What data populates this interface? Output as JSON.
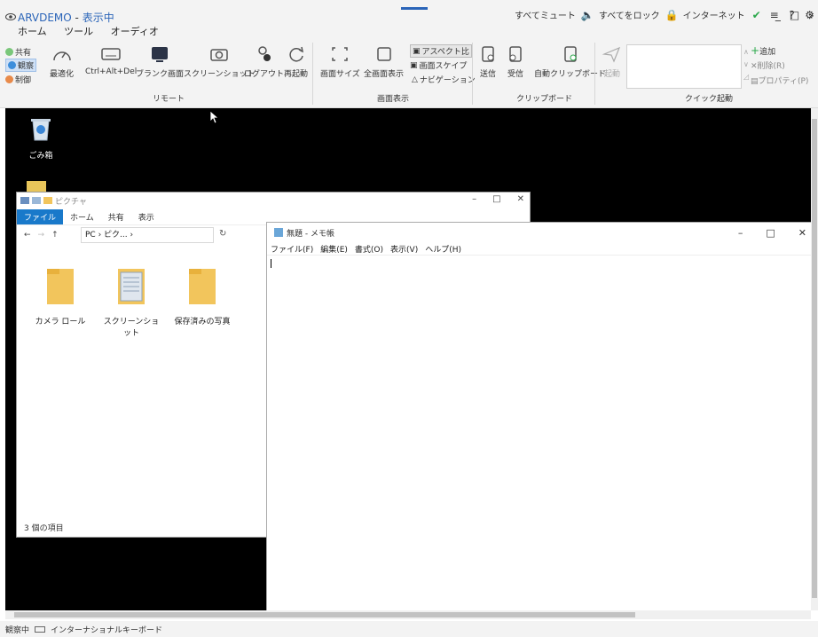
{
  "app": {
    "name": "ARVDEMO",
    "dash": " - ",
    "state": "表示中",
    "tabs": [
      "ホーム",
      "ツール",
      "オーディオ"
    ]
  },
  "top_right": {
    "mute_all": "すべてミュート",
    "lock_all": "すべてをロック",
    "internet": "インターネット",
    "icons": [
      "speaker-icon",
      "lock-icon",
      "check-circle-icon",
      "menu-icon",
      "help-icon",
      "gear-icon"
    ]
  },
  "ribbon": {
    "mode": {
      "share": "共有",
      "view": "観察",
      "control": "制御"
    },
    "remote": {
      "optimize": "最適化",
      "ctrl_alt_del": "Ctrl+Alt+Del",
      "blank_screen": "ブランク画面",
      "screenshot": "スクリーンショット",
      "logout": "ログアウト",
      "restart": "再起動",
      "group_label": "リモート"
    },
    "display": {
      "screen_size": "画面サイズ",
      "fullscreen": "全画面表示",
      "aspect": "アスペクト比",
      "screen_scale": "画面スケイプ",
      "navigation": "ナビゲーション",
      "group_label": "画面表示"
    },
    "clipboard": {
      "send": "送信",
      "receive": "受信",
      "auto_clipboard": "自動クリップボード",
      "group_label": "クリップボード"
    },
    "quick": {
      "launch": "起動",
      "add": "追加",
      "delete": "削除(R)",
      "properties": "プロパティ(P)",
      "group_label": "クイック起動"
    }
  },
  "desktop": {
    "recycle_bin": "ごみ箱",
    "explorer": {
      "title": "ピクチャ",
      "tabs": [
        "ファイル",
        "ホーム",
        "共有",
        "表示"
      ],
      "address": "PC › ピク... ›",
      "folders": [
        "カメラ ロール",
        "スクリーンショット",
        "保存済みの写真"
      ],
      "status": "3 個の項目"
    },
    "notepad": {
      "title": "無題 - メモ帳",
      "menu": [
        "ファイル(F)",
        "編集(E)",
        "書式(O)",
        "表示(V)",
        "ヘルプ(H)"
      ]
    }
  },
  "statusbar": {
    "mode": "観察中",
    "keyboard": "インターナショナルキーボード"
  },
  "colors": {
    "accent": "#2a64b8",
    "file_tab": "#1979ca",
    "folder": "#f2c55c"
  }
}
